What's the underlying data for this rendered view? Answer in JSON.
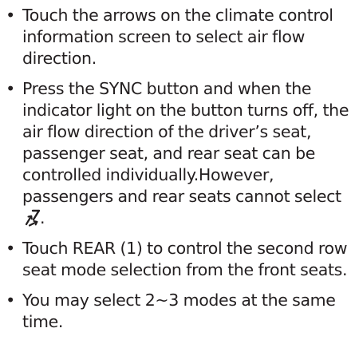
{
  "bullet_char": "•",
  "instructions": [
    {
      "text": "Touch the arrows on the climate control information screen to select air flow direction."
    },
    {
      "text": "Press the SYNC button and when the indicator light on the button turns off, the air flow direction of the driver’s seat, passenger seat, and rear seat can be controlled individually.However, passengers and rear seats cannot select",
      "trailing_icon": "floor-windshield-airflow-icon",
      "suffix": "."
    },
    {
      "text": "Touch REAR (1) to control the second row seat mode selection from the front seats."
    },
    {
      "text": "You may select 2~3 modes at the same time."
    }
  ]
}
